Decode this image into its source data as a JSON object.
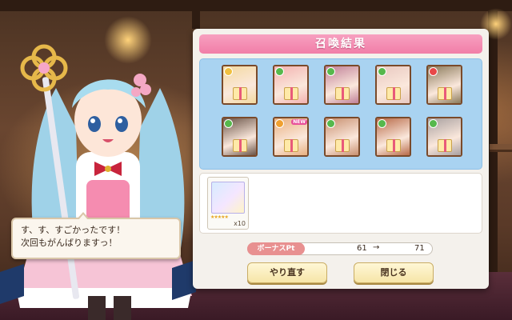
{
  "dialog": {
    "title": "召喚結果",
    "speech_line1": "す、す、すごかったです！",
    "speech_line2": "次回もがんばりますっ！"
  },
  "results": {
    "cards": [
      {
        "attr_color": "#f0c040",
        "tone": "#f3d9a0",
        "new": false
      },
      {
        "attr_color": "#56b84c",
        "tone": "#f3b2b0",
        "new": false
      },
      {
        "attr_color": "#56b84c",
        "tone": "#c08098",
        "new": false
      },
      {
        "attr_color": "#56b84c",
        "tone": "#e8c8c0",
        "new": false
      },
      {
        "attr_color": "#e84848",
        "tone": "#8a7a5a",
        "new": false
      },
      {
        "attr_color": "#56b84c",
        "tone": "#6a5448",
        "new": false
      },
      {
        "attr_color": "#f0a030",
        "tone": "#e8b080",
        "new": true,
        "new_label": "NEW"
      },
      {
        "attr_color": "#56b84c",
        "tone": "#c89070",
        "new": false
      },
      {
        "attr_color": "#56b84c",
        "tone": "#b86a48",
        "new": false
      },
      {
        "attr_color": "#56b84c",
        "tone": "#a8a0a0",
        "new": false
      }
    ],
    "item": {
      "count": "x10",
      "stars": "★★★★★"
    }
  },
  "bonus": {
    "label": "ボーナスPt",
    "before": "61",
    "arrow": "→",
    "after": "71"
  },
  "buttons": {
    "retry": "やり直す",
    "close": "閉じる"
  },
  "colors": {
    "title_pink": "#f17ea8",
    "grid_blue": "#a9d3f1",
    "button_cream": "#f6e5a8"
  }
}
